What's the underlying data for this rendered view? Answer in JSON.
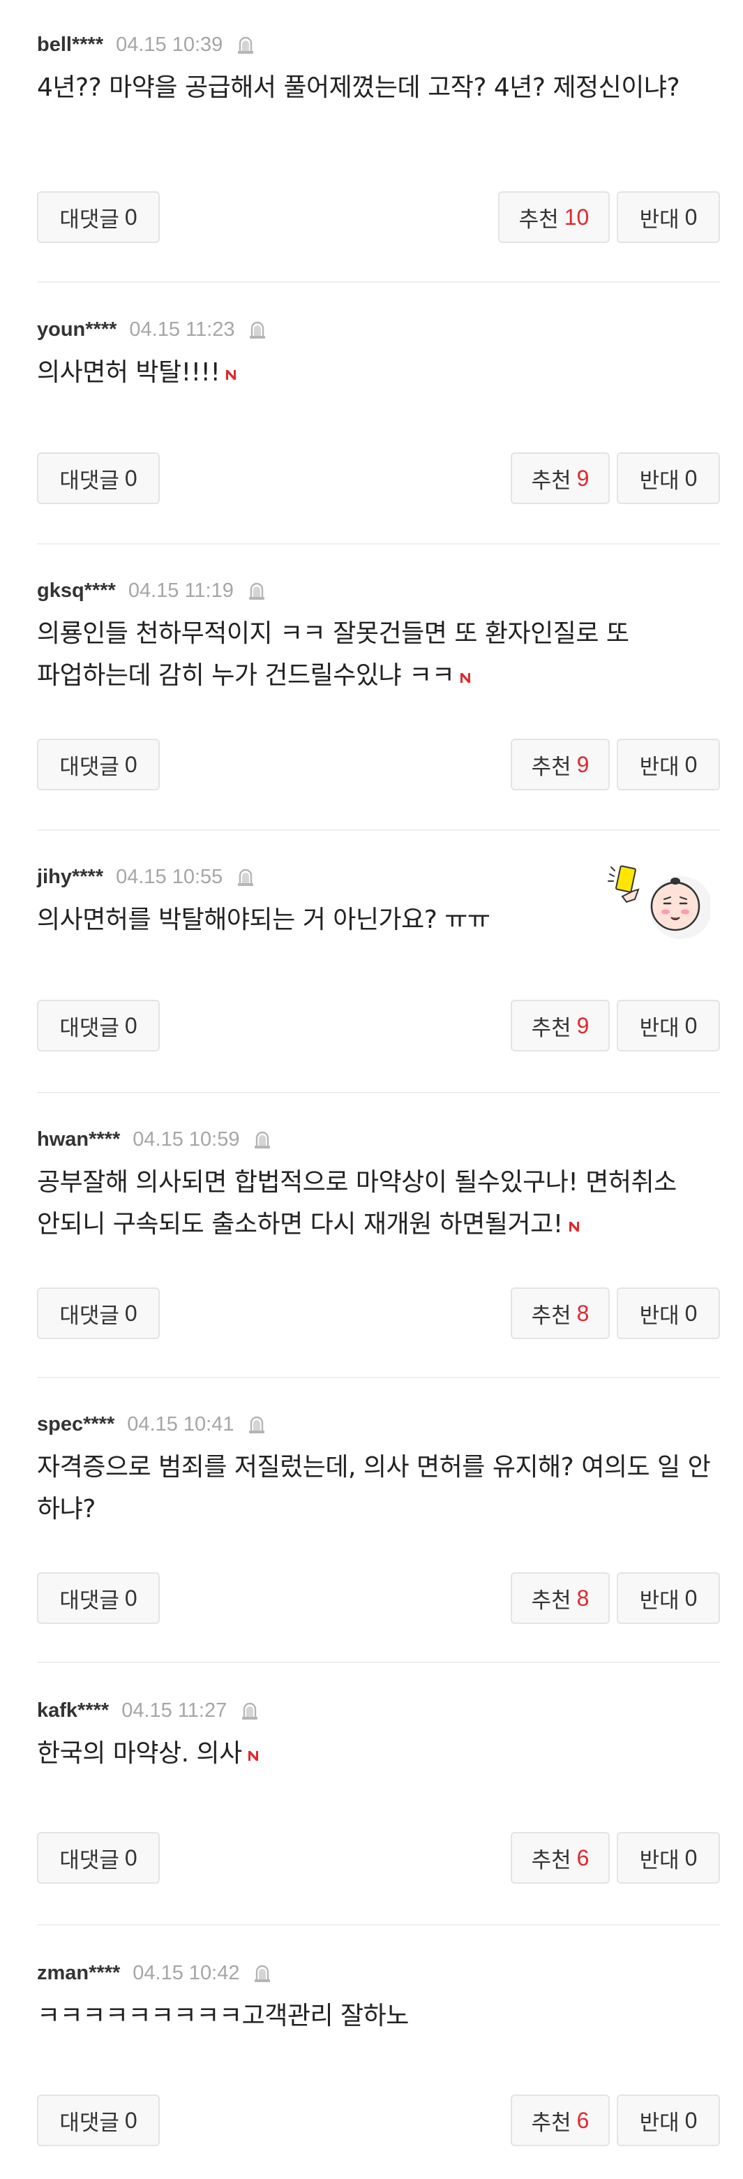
{
  "labels": {
    "reply": "대댓글",
    "upvote": "추천",
    "downvote": "반대"
  },
  "colors": {
    "upvote_count": "#e0282e",
    "new_badge": "#e0282e",
    "divider": "#efefef",
    "button_border": "#e4e4e4"
  },
  "comments": [
    {
      "user": "bell****",
      "time": "04.15 10:39",
      "text": "4년?? 마약을 공급해서 풀어제꼈는데 고작? 4년? 제정신이냐?",
      "new_badge": false,
      "replies": "0",
      "upvotes": "10",
      "downvotes": "0"
    },
    {
      "user": "youn****",
      "time": "04.15 11:23",
      "text": "의사면허 박탈!!!!",
      "new_badge": true,
      "replies": "0",
      "upvotes": "9",
      "downvotes": "0"
    },
    {
      "user": "gksq****",
      "time": "04.15 11:19",
      "text": "의룡인들 천하무적이지 ㅋㅋ 잘못건들면 또 환자인질로 또 파업하는데 감히 누가 건드릴수있냐 ㅋㅋ",
      "new_badge": true,
      "replies": "0",
      "upvotes": "9",
      "downvotes": "0"
    },
    {
      "user": "jihy****",
      "time": "04.15 10:55",
      "text": "의사면허를 박탈해야되는 거 아닌가요? ㅠㅠ",
      "new_badge": false,
      "has_sticker": true,
      "replies": "0",
      "upvotes": "9",
      "downvotes": "0"
    },
    {
      "user": "hwan****",
      "time": "04.15 10:59",
      "text": "공부잘해 의사되면 합법적으로 마약상이 될수있구나! 면허취소 안되니 구속되도 출소하면 다시 재개원 하면될거고!",
      "new_badge": true,
      "replies": "0",
      "upvotes": "8",
      "downvotes": "0"
    },
    {
      "user": "spec****",
      "time": "04.15 10:41",
      "text": "자격증으로 범죄를 저질렀는데, 의사 면허를 유지해? 여의도 일 안 하냐?",
      "new_badge": false,
      "replies": "0",
      "upvotes": "8",
      "downvotes": "0"
    },
    {
      "user": "kafk****",
      "time": "04.15 11:27",
      "text": "한국의 마약상. 의사",
      "new_badge": true,
      "replies": "0",
      "upvotes": "6",
      "downvotes": "0"
    },
    {
      "user": "zman****",
      "time": "04.15 10:42",
      "text": "ㅋㅋㅋㅋㅋㅋㅋㅋㅋ고객관리 잘하노",
      "new_badge": false,
      "replies": "0",
      "upvotes": "6",
      "downvotes": "0"
    }
  ]
}
